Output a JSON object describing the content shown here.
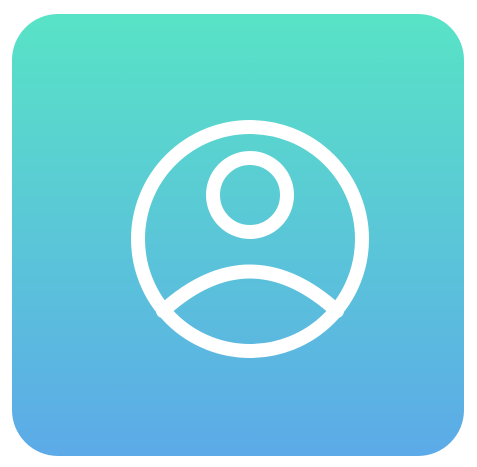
{
  "app_icon": {
    "icon_name": "user-account-icon",
    "gradient_top": "#58E3C6",
    "gradient_bottom": "#5CAAE8",
    "glyph_color": "#FFFFFF"
  }
}
